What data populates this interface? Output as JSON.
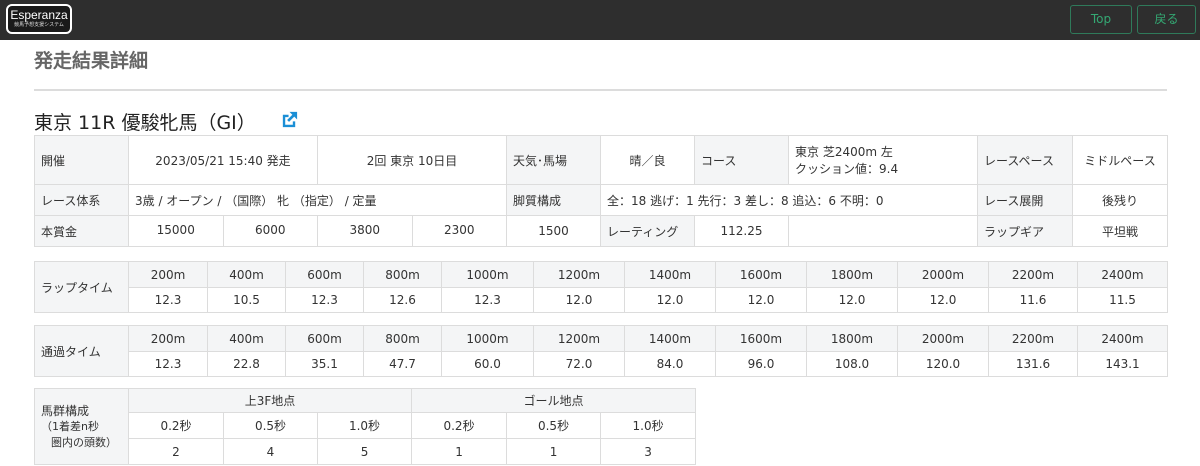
{
  "header": {
    "logo_text": "Esperanza",
    "logo_sub": "競馬予想支援システム",
    "top_label": "Top",
    "back_label": "戻る"
  },
  "page_heading": "発走結果詳細",
  "race_title": "東京 11R  優駿牝馬（GI）",
  "info": {
    "kaisai_label": "開催",
    "start_time": "2023/05/21 15:40 発走",
    "meeting": "2回 東京  10日目",
    "weather_label": "天気･馬場",
    "weather_value": "晴／良",
    "course_label": "コース",
    "course_value_1": "東京 芝2400m  左",
    "course_value_2": "クッション値：9.4",
    "pace_label": "レースペース",
    "pace_value": "ミドルペース",
    "class_label": "レース体系",
    "class_value": "3歳 / オープン /  （国際）  牝  （指定）  / 定量",
    "style_label": "脚質構成",
    "style_value": "全：18    逃げ：1    先行：3    差し：8    追込：6    不明：0",
    "development_label": "レース展開",
    "development_value": "後残り",
    "prize_label": "本賞金",
    "prizes": [
      "15000",
      "6000",
      "3800",
      "2300",
      "1500"
    ],
    "rating_label": "レーティング",
    "rating_value": "112.25",
    "lap_gear_label": "ラップギア",
    "lap_gear_value": "平坦戦"
  },
  "distances": [
    "200m",
    "400m",
    "600m",
    "800m",
    "1000m",
    "1200m",
    "1400m",
    "1600m",
    "1800m",
    "2000m",
    "2200m",
    "2400m"
  ],
  "lap_time": {
    "label": "ラップタイム",
    "values": [
      "12.3",
      "10.5",
      "12.3",
      "12.6",
      "12.3",
      "12.0",
      "12.0",
      "12.0",
      "12.0",
      "12.0",
      "11.6",
      "11.5"
    ]
  },
  "passing_time": {
    "label": "通過タイム",
    "values": [
      "12.3",
      "22.8",
      "35.1",
      "47.7",
      "60.0",
      "72.0",
      "84.0",
      "96.0",
      "108.0",
      "120.0",
      "131.6",
      "143.1"
    ]
  },
  "group": {
    "label_1": "馬群構成",
    "label_2": "（1着差n秒",
    "label_3": "圏内の頭数）",
    "last3f": "上3F地点",
    "goal": "ゴール地点",
    "seconds": [
      "0.2秒",
      "0.5秒",
      "1.0秒",
      "0.2秒",
      "0.5秒",
      "1.0秒"
    ],
    "counts": [
      "2",
      "4",
      "5",
      "1",
      "1",
      "3"
    ]
  }
}
